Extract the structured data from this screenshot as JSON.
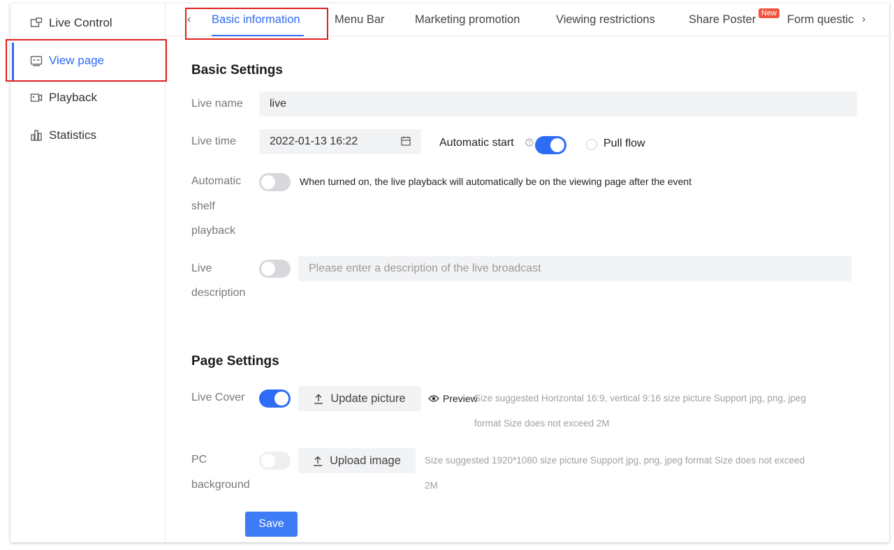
{
  "sidebar": {
    "items": [
      {
        "label": "Live Control",
        "icon": "live-control-icon"
      },
      {
        "label": "View page",
        "icon": "view-page-icon",
        "active": true
      },
      {
        "label": "Playback",
        "icon": "playback-icon"
      },
      {
        "label": "Statistics",
        "icon": "statistics-icon"
      }
    ]
  },
  "tabs": {
    "items": [
      {
        "label": "Basic information",
        "active": true
      },
      {
        "label": "Menu Bar"
      },
      {
        "label": "Marketing promotion"
      },
      {
        "label": "Viewing restrictions"
      },
      {
        "label": "Share Poster"
      },
      {
        "label": "Form questic"
      }
    ],
    "new_badge": "New"
  },
  "basic_settings": {
    "title": "Basic Settings",
    "live_name": {
      "label": "Live name",
      "value": "live"
    },
    "live_time": {
      "label": "Live time",
      "value": "2022-01-13 16:22"
    },
    "automatic_start": {
      "label": "Automatic start",
      "enabled": true
    },
    "pull_flow": {
      "label": "Pull flow",
      "selected": false
    },
    "auto_shelf": {
      "label_lines": [
        "Automatic",
        "shelf",
        "playback"
      ],
      "enabled": false,
      "description": "When turned on, the live playback will automatically be on the viewing page after the event"
    },
    "live_description": {
      "label_lines": [
        "Live",
        "description"
      ],
      "enabled": false,
      "placeholder": "Please enter a description of the live broadcast"
    }
  },
  "page_settings": {
    "title": "Page Settings",
    "live_cover": {
      "label": "Live Cover",
      "enabled": true,
      "button_label": "Update picture",
      "preview_label": "Preview",
      "hint_lines": [
        "Size suggested Horizontal 16:9, vertical 9:16 size picture  Support jpg, png,  jpeg",
        "format  Size does not exceed 2M"
      ]
    },
    "pc_background": {
      "label_lines": [
        "PC",
        "background"
      ],
      "enabled": false,
      "button_label": "Upload image",
      "hint_lines": [
        "Size suggested 1920*1080 size picture  Support jpg, png,  jpeg format  Size does not exceed",
        "2M"
      ]
    }
  },
  "actions": {
    "save_label": "Save"
  },
  "colors": {
    "accent": "#2f6cf5",
    "highlight_border": "#e02020",
    "badge": "#f2553d"
  }
}
